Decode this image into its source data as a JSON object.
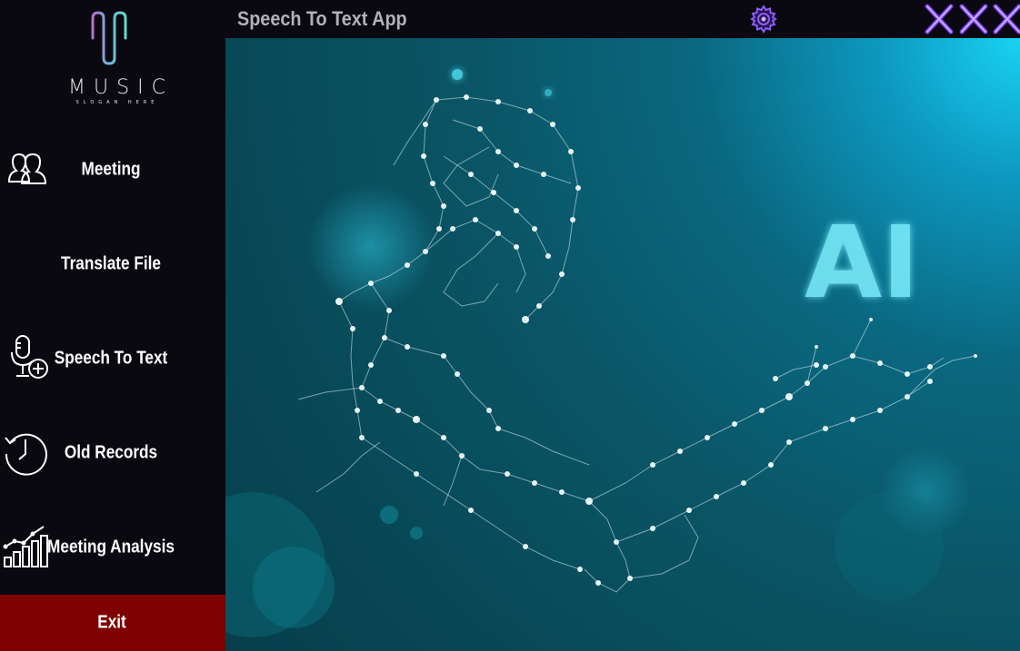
{
  "logo": {
    "title": "MUSIC",
    "slogan": "SLOGAN HERE",
    "icon": "sound-wave-logo"
  },
  "sidebar": {
    "items": [
      {
        "label": "Meeting",
        "icon": "people-icon"
      },
      {
        "label": "Translate File",
        "icon": ""
      },
      {
        "label": "Speech To Text",
        "icon": "microphone-add-icon"
      },
      {
        "label": "Old Records",
        "icon": "clock-history-icon"
      },
      {
        "label": "Meeting Analysis",
        "icon": "bar-chart-trend-icon"
      }
    ],
    "exit_label": "Exit"
  },
  "titlebar": {
    "title": "Speech To Text App",
    "buttons": [
      "settings-gear-icon",
      "close-icon",
      "close-icon",
      "close-icon"
    ]
  },
  "main": {
    "hero_text": "AI",
    "background": "network-robot-hand-illustration"
  },
  "colors": {
    "sidebar_bg": "#0b0910",
    "exit_bg": "#7f0000",
    "accent_purple": "#8b5cf6",
    "title_text": "#b0b2b6",
    "hero_bg": "#0a5566"
  }
}
